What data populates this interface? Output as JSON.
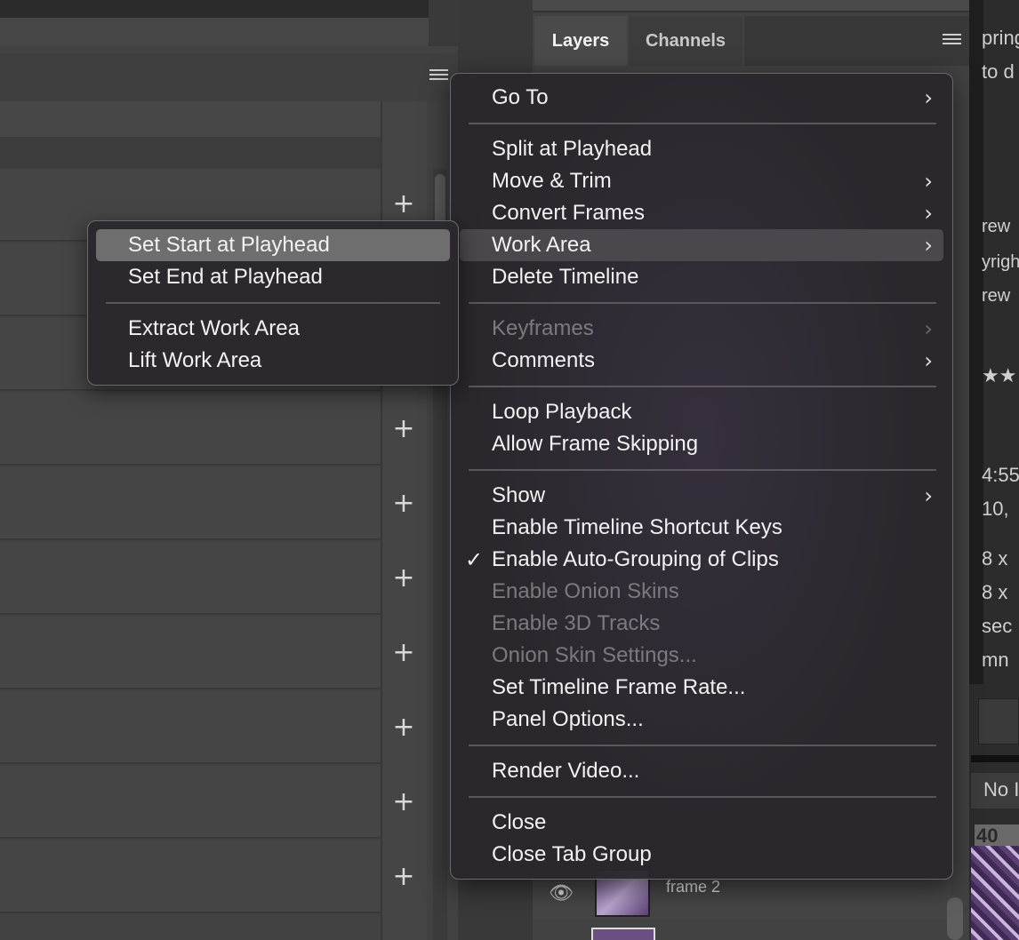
{
  "layers_panel": {
    "tabs": [
      {
        "label": "Layers",
        "active": true
      },
      {
        "label": "Channels",
        "active": false
      }
    ],
    "visible_layer": {
      "name": "frame 2"
    }
  },
  "right_strip_fragments": [
    "pring",
    "to d",
    "rew",
    "yrigh",
    "rew",
    "★★",
    "4:55",
    "10,",
    "8 x",
    "8 x",
    "sec",
    "mn",
    "No I",
    "40"
  ],
  "menu": {
    "items": [
      {
        "label": "Go To",
        "submenu": true,
        "disabled": false
      },
      {
        "label": "Split at Playhead",
        "submenu": false,
        "disabled": false
      },
      {
        "label": "Move & Trim",
        "submenu": true,
        "disabled": false
      },
      {
        "label": "Convert Frames",
        "submenu": true,
        "disabled": false
      },
      {
        "label": "Work Area",
        "submenu": true,
        "disabled": false,
        "highlighted": true
      },
      {
        "label": "Delete Timeline",
        "submenu": false,
        "disabled": false
      },
      {
        "label": "Keyframes",
        "submenu": true,
        "disabled": true
      },
      {
        "label": "Comments",
        "submenu": true,
        "disabled": false
      },
      {
        "label": "Loop Playback",
        "submenu": false,
        "disabled": false
      },
      {
        "label": "Allow Frame Skipping",
        "submenu": false,
        "disabled": false
      },
      {
        "label": "Show",
        "submenu": true,
        "disabled": false
      },
      {
        "label": "Enable Timeline Shortcut Keys",
        "submenu": false,
        "disabled": false
      },
      {
        "label": "Enable Auto-Grouping of Clips",
        "submenu": false,
        "disabled": false,
        "checked": true
      },
      {
        "label": "Enable Onion Skins",
        "submenu": false,
        "disabled": true
      },
      {
        "label": "Enable 3D Tracks",
        "submenu": false,
        "disabled": true
      },
      {
        "label": "Onion Skin Settings...",
        "submenu": false,
        "disabled": true
      },
      {
        "label": "Set Timeline Frame Rate...",
        "submenu": false,
        "disabled": false
      },
      {
        "label": "Panel Options...",
        "submenu": false,
        "disabled": false
      },
      {
        "label": "Render Video...",
        "submenu": false,
        "disabled": false
      },
      {
        "label": "Close",
        "submenu": false,
        "disabled": false
      },
      {
        "label": "Close Tab Group",
        "submenu": false,
        "disabled": false
      }
    ],
    "check_glyph": "✓",
    "chevron_glyph": "›"
  },
  "submenu": {
    "parent": "Work Area",
    "items": [
      {
        "label": "Set Start at Playhead",
        "selected": true
      },
      {
        "label": "Set End at Playhead",
        "selected": false
      },
      {
        "label": "Extract Work Area",
        "selected": false
      },
      {
        "label": "Lift Work Area",
        "selected": false
      }
    ]
  },
  "timeline": {
    "add_track_icon": "+"
  },
  "colors": {
    "menu_bg": "#2a282d",
    "menu_highlight": "#4a474d",
    "submenu_selected": "#6e6e6e",
    "disabled_text": "#7c7a7f",
    "panel_bg": "#424242"
  }
}
